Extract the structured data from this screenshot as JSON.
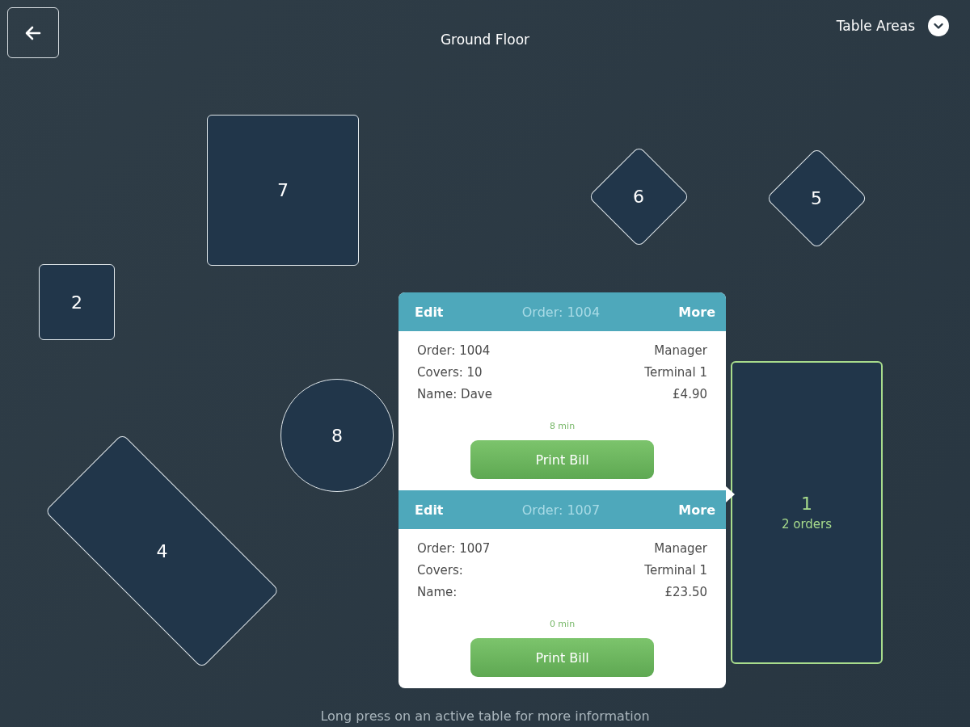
{
  "top_bar": {
    "title": "Ground Floor",
    "areas_label": "Table Areas"
  },
  "tables": [
    {
      "label": "7",
      "kind": "square",
      "selected": false
    },
    {
      "label": "6",
      "kind": "diamond",
      "selected": false
    },
    {
      "label": "5",
      "kind": "diamond",
      "selected": false
    },
    {
      "label": "2",
      "kind": "square",
      "selected": false
    },
    {
      "label": "8",
      "kind": "circle",
      "selected": false
    },
    {
      "label": "4",
      "kind": "slanted",
      "selected": false
    },
    {
      "label": "1",
      "kind": "rect",
      "selected": true,
      "orders": "2 orders"
    }
  ],
  "popover": {
    "orders": [
      {
        "edit": "Edit",
        "title": "Order: 1004",
        "more": "More",
        "details": [
          "Order: 1004",
          "Covers: 10",
          "Name: Dave"
        ],
        "info": [
          "Manager",
          "Terminal 1",
          "£4.90"
        ],
        "time": "8 min",
        "button": "Print Bill"
      },
      {
        "edit": "Edit",
        "title": "Order: 1007",
        "more": "More",
        "details": [
          "Order: 1007",
          "Covers:",
          "Name:"
        ],
        "info": [
          "Manager",
          "Terminal 1",
          "£23.50"
        ],
        "time": "0 min",
        "button": "Print Bill"
      }
    ]
  },
  "hint": "Long press on an active table for more information"
}
